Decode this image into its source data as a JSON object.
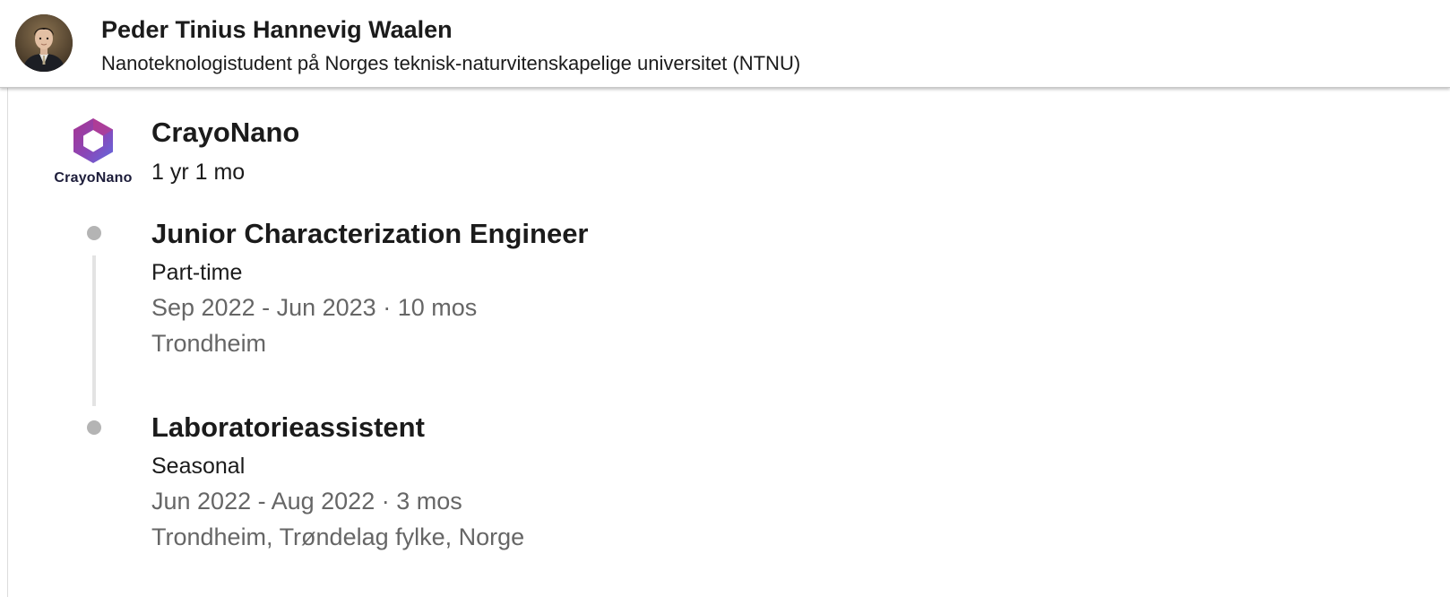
{
  "header": {
    "name": "Peder Tinius Hannevig Waalen",
    "headline": "Nanoteknologistudent på Norges teknisk-naturvitenskapelige universitet (NTNU)"
  },
  "company": {
    "logo_text": "CrayoNano",
    "name": "CrayoNano",
    "duration": "1 yr 1 mo",
    "logo_colors": [
      "#9b3f9c",
      "#6a5bd6"
    ]
  },
  "positions": [
    {
      "title": "Junior Characterization Engineer",
      "employment_type": "Part-time",
      "dates": "Sep 2022 - Jun 2023 · 10 mos",
      "location": "Trondheim"
    },
    {
      "title": "Laboratorieassistent",
      "employment_type": "Seasonal",
      "dates": "Jun 2022 - Aug 2022 · 3 mos",
      "location": "Trondheim, Trøndelag fylke, Norge"
    }
  ]
}
